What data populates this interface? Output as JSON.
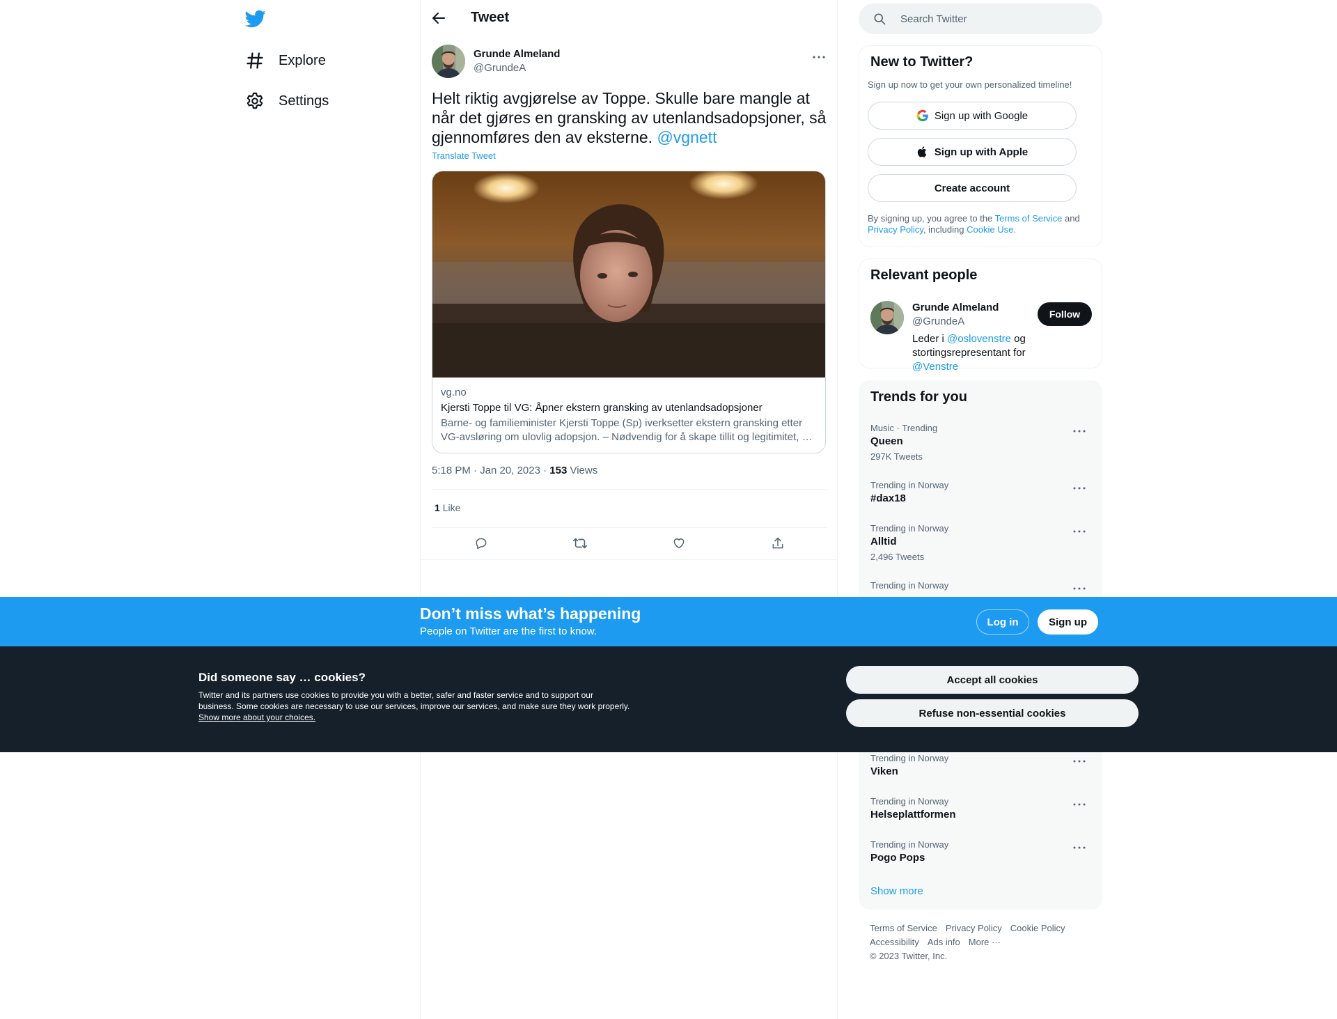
{
  "nav": {
    "items": [
      {
        "label": "Explore",
        "icon": "hashtag-icon"
      },
      {
        "label": "Settings",
        "icon": "gear-icon"
      }
    ]
  },
  "header": {
    "title": "Tweet"
  },
  "tweet": {
    "author_name": "Grunde Almeland",
    "author_handle": "@GrundeA",
    "text": "Helt riktig avgjørelse av Toppe. Skulle bare mangle at når det gjøres en gransking av utenlandsadopsjoner, så gjennomføres den av eksterne.",
    "mention": "@vgnett",
    "translate_label": "Translate Tweet",
    "card": {
      "domain": "vg.no",
      "title": "Kjersti Toppe til VG: Åpner ekstern gransking av utenlandsadopsjoner",
      "description": "Barne- og familieminister Kjersti Toppe (Sp) iverksetter ekstern gransking etter VG-avsløring om ulovlig adopsjon. – Nødvendig for å skape tillit og legitimitet, …"
    },
    "timestamp": "5:18 PM · Jan 20, 2023 · ",
    "views_count": "153",
    "views_label": "Views",
    "likes_count": "1",
    "likes_label": "Like"
  },
  "search": {
    "placeholder": "Search Twitter"
  },
  "signup": {
    "title": "New to Twitter?",
    "subtitle": "Sign up now to get your own personalized timeline!",
    "google_label": "Sign up with Google",
    "apple_label": "Sign up with Apple",
    "create_label": "Create account",
    "legal_prefix": "By signing up, you agree to the ",
    "terms_link": "Terms of Service",
    "legal_and": " and ",
    "privacy_link": "Privacy Policy",
    "legal_including": ", including ",
    "cookie_link": "Cookie Use."
  },
  "relevant": {
    "title": "Relevant people",
    "name": "Grunde Almeland",
    "handle": "@GrundeA",
    "follow_label": "Follow",
    "bio_prefix": "Leder i ",
    "bio_mention1": "@oslovenstre",
    "bio_mid": " og stortingsrepresentant for ",
    "bio_mention2": "@Venstre"
  },
  "trends": {
    "title": "Trends for you",
    "items": [
      {
        "meta": "Music · Trending",
        "name": "Queen",
        "count": "297K Tweets"
      },
      {
        "meta": "Trending in Norway",
        "name": "#dax18",
        "count": ""
      },
      {
        "meta": "Trending in Norway",
        "name": "Alltid",
        "count": "2,496 Tweets"
      },
      {
        "meta": "Trending in Norway",
        "name": "",
        "count": ""
      },
      {
        "meta": "Trending in Norway",
        "name": "Viken",
        "count": ""
      },
      {
        "meta": "Trending in Norway",
        "name": "Helseplattformen",
        "count": ""
      },
      {
        "meta": "Trending in Norway",
        "name": "Pogo Pops",
        "count": ""
      }
    ],
    "show_more": "Show more"
  },
  "footer": {
    "links": [
      "Terms of Service",
      "Privacy Policy",
      "Cookie Policy",
      "Accessibility",
      "Ads info",
      "More ···"
    ],
    "copyright": "© 2023 Twitter, Inc."
  },
  "banner": {
    "title": "Don’t miss what’s happening",
    "subtitle": "People on Twitter are the first to know.",
    "login_label": "Log in",
    "signup_label": "Sign up"
  },
  "cookies": {
    "title": "Did someone say … cookies?",
    "text": "Twitter and its partners use cookies to provide you with a better, safer and faster service and to support our business. Some cookies are necessary to use our services, improve our services, and make sure they work properly. ",
    "link": "Show more about your choices.",
    "accept_label": "Accept all cookies",
    "refuse_label": "Refuse non-essential cookies"
  },
  "colors": {
    "accent": "#1d9bf0",
    "text": "#0f1419",
    "muted": "#536471",
    "cookie_bg": "#16202a"
  }
}
